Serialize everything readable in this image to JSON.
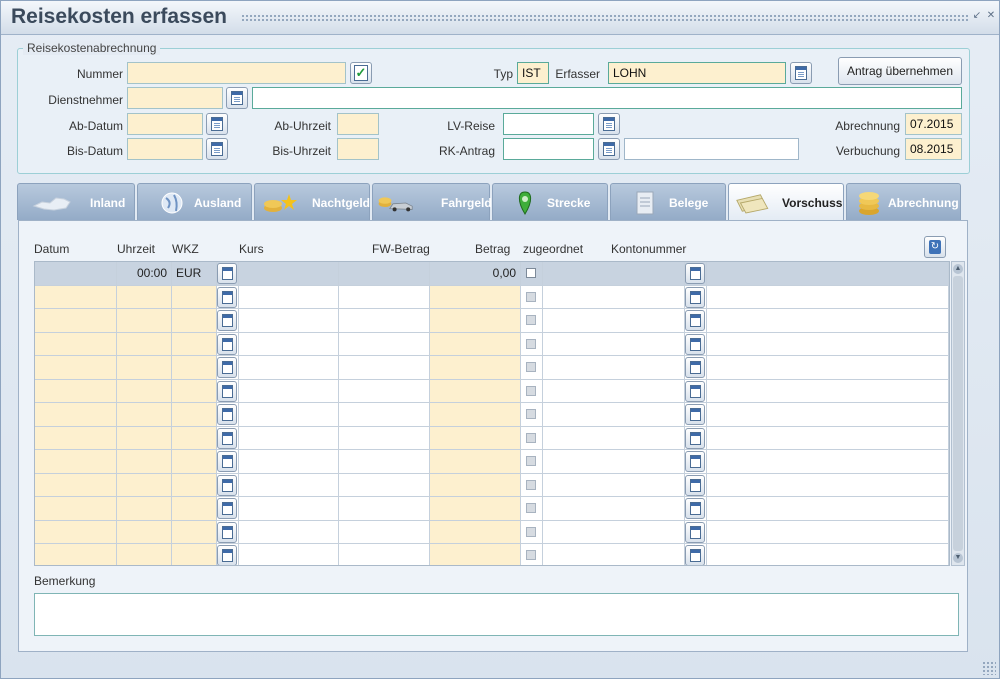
{
  "window": {
    "title": "Reisekosten erfassen"
  },
  "group": {
    "legend": "Reisekostenabrechnung",
    "nummer_label": "Nummer",
    "nummer_value": "",
    "dienstnehmer_label": "Dienstnehmer",
    "dienstnehmer_value": "",
    "dienstnehmer_name": "",
    "ab_datum_label": "Ab-Datum",
    "ab_datum_value": "",
    "bis_datum_label": "Bis-Datum",
    "bis_datum_value": "",
    "ab_uhrzeit_label": "Ab-Uhrzeit",
    "ab_uhrzeit_value": "",
    "bis_uhrzeit_label": "Bis-Uhrzeit",
    "bis_uhrzeit_value": "",
    "typ_label": "Typ",
    "typ_value": "IST",
    "erfasser_label": "Erfasser",
    "erfasser_value": "LOHN",
    "lv_reise_label": "LV-Reise",
    "lv_reise_value": "",
    "rk_antrag_label": "RK-Antrag",
    "rk_antrag_value": "",
    "rk_antrag_text": "",
    "antrag_button": "Antrag übernehmen",
    "abrechnung_label": "Abrechnung",
    "abrechnung_value": "07.2015",
    "verbuchung_label": "Verbuchung",
    "verbuchung_value": "08.2015"
  },
  "tabs": [
    {
      "label": "Inland",
      "icon": "austria-map-icon"
    },
    {
      "label": "Ausland",
      "icon": "globe-icon"
    },
    {
      "label": "Nachtgeld",
      "icon": "coins-stars-icon"
    },
    {
      "label": "Fahrgeld",
      "icon": "coins-car-icon"
    },
    {
      "label": "Strecke",
      "icon": "map-pin-icon"
    },
    {
      "label": "Belege",
      "icon": "receipt-icon"
    },
    {
      "label": "Vorschuss",
      "icon": "banknotes-icon",
      "active": true
    },
    {
      "label": "Abrechnung",
      "icon": "coin-stack-icon"
    }
  ],
  "table": {
    "columns": [
      "Datum",
      "Uhrzeit",
      "WKZ",
      "Kurs",
      "FW-Betrag",
      "Betrag",
      "zugeordnet",
      "Kontonummer"
    ],
    "first_row": {
      "datum": "",
      "uhrzeit": "00:00",
      "wkz": "EUR",
      "kurs": "",
      "fw_betrag": "",
      "betrag": "0,00",
      "zugeordnet": false,
      "kontonummer": ""
    }
  },
  "bemerkung": {
    "label": "Bemerkung",
    "value": ""
  },
  "colors": {
    "field_yellow": "#fdf0cf",
    "tab_active": "#ffffff",
    "tab_inactive": "#a6bad3"
  }
}
